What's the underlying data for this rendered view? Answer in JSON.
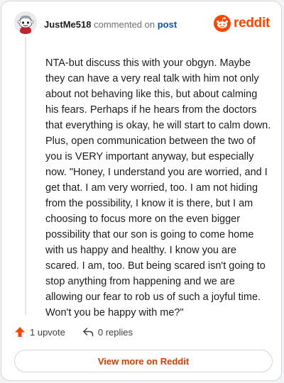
{
  "comment": {
    "author": "JustMe518",
    "action_text": "commented on",
    "post_link_label": "post",
    "text": "NTA-but discuss this with your obgyn. Maybe they can have a very real talk with him not only about not behaving like this, but about calming his fears. Perhaps if he hears from the doctors that everything is okay, he will start to calm down. Plus, open communication between the two of you is VERY important anyway, but especially now. \"Honey, I understand you are worried, and I get that. I am very worried, too. I am not hiding from the possibility, I know it is there, but I am choosing to focus more on the even bigger possibility that our son is going to come home with us happy and healthy. I know you are scared. I am, too. But being scared isn't going to stop anything from happening and we are allowing our fear to rob us of such a joyful time. Won't you be happy with me?\"",
    "upvotes_label": "1 upvote",
    "replies_label": "0 replies"
  },
  "branding": {
    "wordmark": "reddit",
    "logo_icon": "reddit-snoo-icon",
    "accent_color": "#ff4500"
  },
  "footer": {
    "view_more_label": "View more on Reddit"
  },
  "icons": {
    "avatar": "snoo-avatar",
    "upvote": "upvote-arrow-icon",
    "reply": "reply-arrow-icon"
  },
  "colors": {
    "upvote": "#ff4500",
    "link": "#0a53b6",
    "button_text": "#d93a00"
  }
}
